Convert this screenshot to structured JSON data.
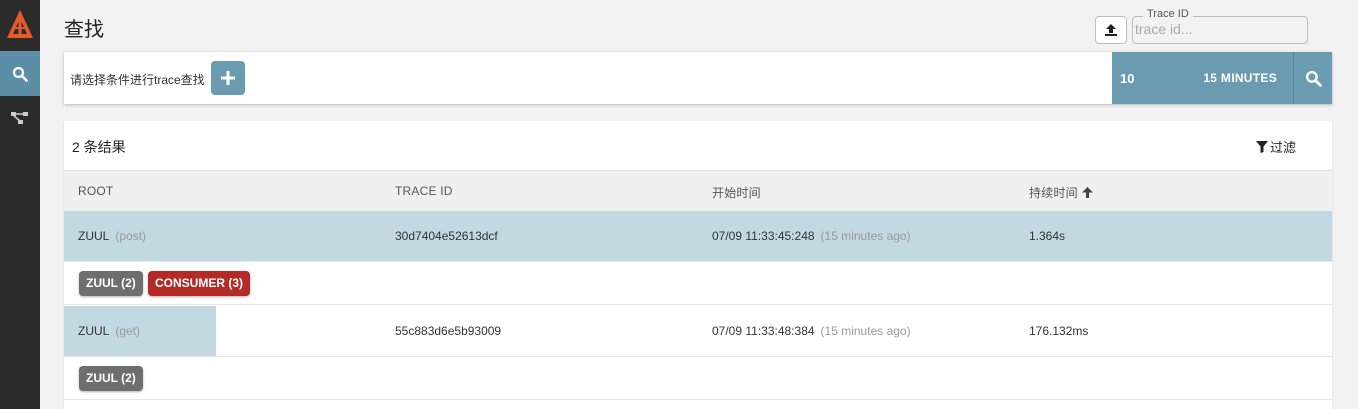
{
  "page": {
    "title": "查找"
  },
  "sidebar": {
    "items": [
      {
        "icon": "zipkin-logo-icon"
      },
      {
        "icon": "search-icon",
        "active": true
      },
      {
        "icon": "dependencies-icon"
      }
    ]
  },
  "trace_lookup": {
    "legend": "Trace ID",
    "placeholder": "trace id..."
  },
  "search": {
    "hint": "请选择条件进行trace查找",
    "limit": "10",
    "lookback": "15 MINUTES"
  },
  "results": {
    "count_text": "2 条结果",
    "filter_label": "过滤",
    "columns": [
      "ROOT",
      "TRACE ID",
      "开始时间",
      "持续时间"
    ],
    "rows": [
      {
        "service": "ZUUL",
        "method": "(post)",
        "trace_id": "30d7404e52613dcf",
        "start": "07/09 11:33:45:248",
        "ago": "(15 minutes ago)",
        "duration": "1.364s",
        "duration_fraction": 1.0,
        "badges": [
          {
            "label": "ZUUL (2)",
            "color": "#6e6e6e"
          },
          {
            "label": "CONSUMER (3)",
            "color": "#b22b27"
          }
        ]
      },
      {
        "service": "ZUUL",
        "method": "(get)",
        "trace_id": "55c883d6e5b93009",
        "start": "07/09 11:33:48:384",
        "ago": "(15 minutes ago)",
        "duration": "176.132ms",
        "duration_fraction": 0.12,
        "badges": [
          {
            "label": "ZUUL (2)",
            "color": "#6e6e6e"
          }
        ]
      }
    ]
  },
  "colors": {
    "accent": "#6b9bb0",
    "sidebar": "#2b2b2b",
    "row_fill": "#c3d9e1"
  }
}
